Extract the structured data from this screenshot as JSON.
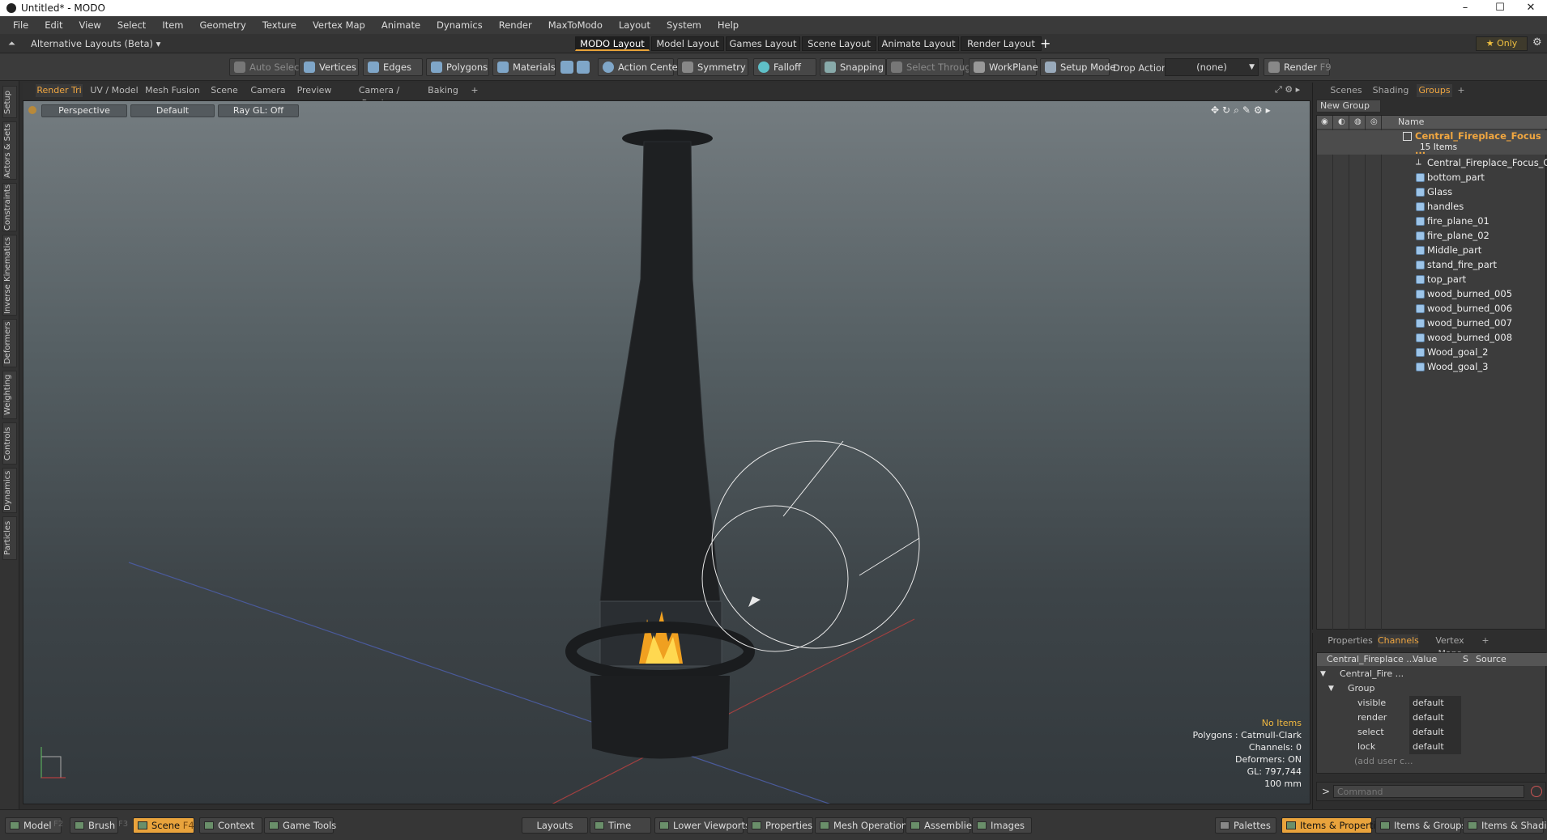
{
  "window": {
    "title": "Untitled* - MODO",
    "minimize": "–",
    "maximize": "☐",
    "close": "✕"
  },
  "menu": [
    "File",
    "Edit",
    "View",
    "Select",
    "Item",
    "Geometry",
    "Texture",
    "Vertex Map",
    "Animate",
    "Dynamics",
    "Render",
    "MaxToModo",
    "Layout",
    "System",
    "Help"
  ],
  "layout_bar": {
    "dropdown": "Alternative Layouts (Beta) ▾",
    "tabs": [
      "MODO Layout",
      "Model Layout",
      "Games Layout",
      "Scene Layout",
      "Animate Layout",
      "Render Layout"
    ],
    "add": "+",
    "only": "★  Only"
  },
  "toolbar": {
    "auto_select": "Auto Select",
    "vertices": "Vertices",
    "edges": "Edges",
    "polygons": "Polygons",
    "materials": "Materials",
    "action_center": "Action Center",
    "symmetry": "Symmetry",
    "falloff": "Falloff",
    "snapping": "Snapping",
    "select_through": "Select Through",
    "workplane": "WorkPlane",
    "setup_mode": "Setup Mode",
    "drop_action": "Drop Action",
    "drop_value": "(none)",
    "render": "Render",
    "render_key": "F9"
  },
  "left_tabs": [
    "Setup",
    "Actors & Sets",
    "Constraints",
    "Inverse Kinematics",
    "Deformers",
    "Weighting",
    "Controls",
    "Dynamics",
    "Particles"
  ],
  "viewport_tabs": [
    "Render Tri",
    "UV / Model",
    "Mesh Fusion",
    "Scene",
    "Camera",
    "Preview",
    "Camera / Preview",
    "Baking",
    "+"
  ],
  "viewport": {
    "perspective": "Perspective",
    "shading": "Default",
    "raygl": "Ray GL: Off",
    "info": {
      "items": "No Items",
      "polygons": "Polygons : Catmull-Clark",
      "channels": "Channels: 0",
      "deformers": "Deformers: ON",
      "gl": "GL: 797,744",
      "scale": "100 mm"
    }
  },
  "right_tabs": [
    "Scenes",
    "Shading",
    "Groups",
    "+"
  ],
  "groups": {
    "new_group": "New Group",
    "name_header": "Name",
    "root": "Central_Fireplace_Focus ...",
    "root_count": "15 Items",
    "items": [
      "Central_Fireplace_Focus_C...",
      "bottom_part",
      "Glass",
      "handles",
      "fire_plane_01",
      "fire_plane_02",
      "Middle_part",
      "stand_fire_part",
      "top_part",
      "wood_burned_005",
      "wood_burned_006",
      "wood_burned_007",
      "wood_burned_008",
      "Wood_goal_2",
      "Wood_goal_3"
    ]
  },
  "lower_tabs": [
    "Properties",
    "Channels",
    "Vertex Maps",
    "+"
  ],
  "channels": {
    "col_name": "Central_Fireplace ...",
    "col_value": "Value",
    "col_s": "S",
    "col_source": "Source",
    "root": "Central_Fire ...",
    "group": "Group",
    "rows": [
      {
        "name": "visible",
        "value": "default"
      },
      {
        "name": "render",
        "value": "default"
      },
      {
        "name": "select",
        "value": "default"
      },
      {
        "name": "lock",
        "value": "default"
      }
    ],
    "add": "(add user c..."
  },
  "command": {
    "prompt": ">",
    "placeholder": "Command"
  },
  "bottom": {
    "model": "Model",
    "model_key": "F2",
    "brush": "Brush",
    "brush_key": "F3",
    "scene": "Scene",
    "scene_key": "F4",
    "context": "Context",
    "game_tools": "Game Tools",
    "layouts": "Layouts",
    "time": "Time",
    "lower_viewports": "Lower Viewports",
    "properties": "Properties",
    "mesh_operations": "Mesh Operations",
    "assemblies": "Assemblies",
    "images": "Images",
    "palettes": "Palettes",
    "items_properties": "Items & Properties",
    "items_groups": "Items & Groups",
    "items_shading": "Items & Shading"
  }
}
